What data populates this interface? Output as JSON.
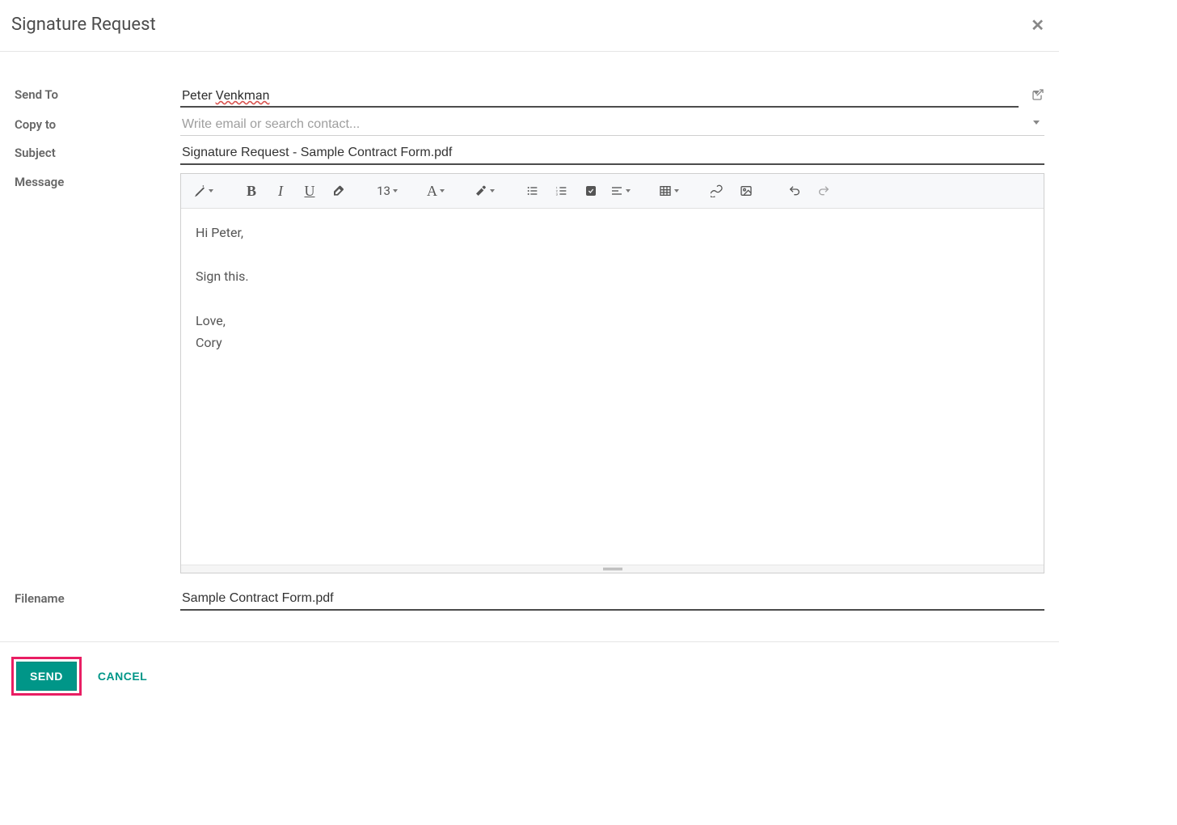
{
  "modal": {
    "title": "Signature Request"
  },
  "form": {
    "labels": {
      "send_to": "Send To",
      "copy_to": "Copy to",
      "subject": "Subject",
      "message": "Message",
      "filename": "Filename"
    },
    "send_to": {
      "first": "Peter",
      "wavy_part": "Venkman"
    },
    "copy_to": {
      "value": "",
      "placeholder": "Write email or search contact..."
    },
    "subject": "Signature Request - Sample Contract Form.pdf",
    "message": {
      "line1": "Hi Peter,",
      "line2": "Sign this.",
      "line3": "Love,",
      "line4": "Cory"
    },
    "filename": "Sample Contract Form.pdf"
  },
  "toolbar": {
    "font_size": "13",
    "bold": "B",
    "italic": "I",
    "underline": "U",
    "font_letter": "A"
  },
  "footer": {
    "send": "SEND",
    "cancel": "CANCEL"
  }
}
